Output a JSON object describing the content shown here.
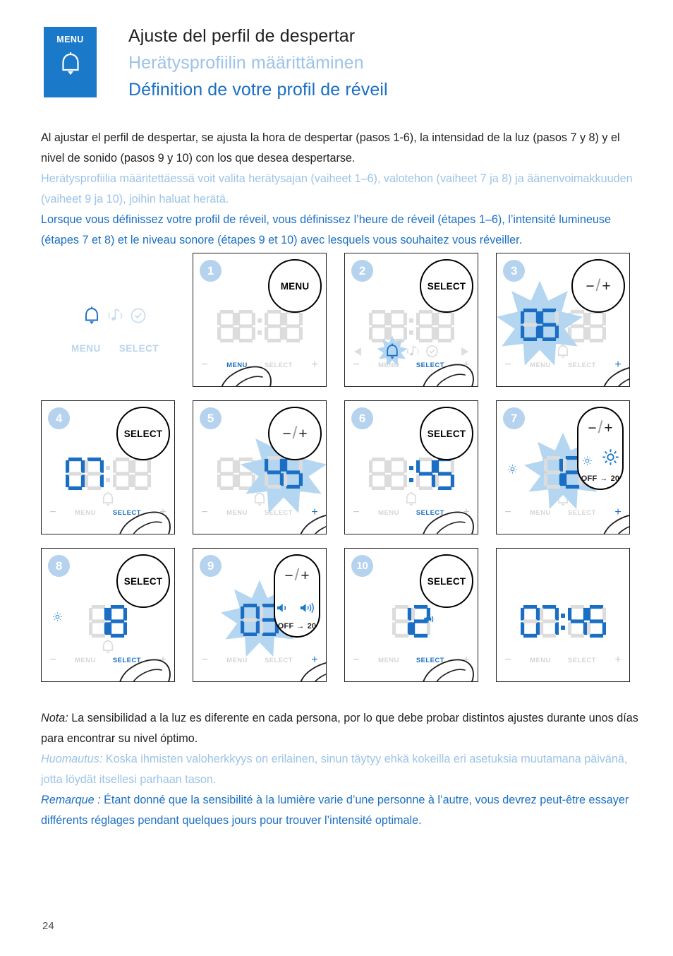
{
  "header": {
    "logo_label": "MENU",
    "logo_icon": "bell-icon",
    "title_es": "Ajuste del perfil de despertar",
    "title_fi": "Herätysprofiilin määrittäminen",
    "title_fr": "Définition de votre profil de réveil"
  },
  "intro": {
    "es": "Al ajustar el perfil de despertar, se ajusta la hora de despertar (pasos 1-6), la intensidad de la luz (pasos 7 y 8) y el nivel de sonido (pasos 9 y 10) con los que desea despertarse.",
    "fi": "Herätysprofiilia määritettäessä voit valita herätysajan (vaiheet 1–6), valotehon (vaiheet 7 ja 8) ja äänenvoimakkuuden (vaiheet 9 ja 10), joihin haluat herätä.",
    "fr": "Lorsque vous définissez votre profil de réveil, vous définissez l’heure de réveil (étapes 1–6), l’intensité lumineuse (étapes 7 et 8) et le niveau sonore (étapes 9 et 10) avec lesquels vous souhaitez vous réveiller."
  },
  "legend": {
    "icons": [
      "bell-icon",
      "music-note-icon",
      "clock-check-icon"
    ],
    "menu_label": "MENU",
    "select_label": "SELECT"
  },
  "steps": [
    {
      "number": "1",
      "button_label": "MENU",
      "button_type": "circle",
      "display": "00:00",
      "display_state": "off",
      "strip": {
        "minus": "−",
        "menu": "MENU",
        "select": "SELECT",
        "plus": "+",
        "highlight": "menu"
      },
      "thumb": true
    },
    {
      "number": "2",
      "button_label": "SELECT",
      "button_type": "circle",
      "display": "06:30",
      "display_state": "off",
      "icon_row": [
        "bell-icon",
        "music-note-icon",
        "clock-check-icon"
      ],
      "icon_row_active": "bell-icon",
      "arrows": true,
      "strip": {
        "minus": "−",
        "menu": "MENU",
        "select": "SELECT",
        "plus": "+",
        "highlight": "select"
      },
      "thumb": true
    },
    {
      "number": "3",
      "button_label": "−/+",
      "button_type": "circle",
      "display": "06:30",
      "display_state": "hours-flashing",
      "bell_under": true,
      "strip": {
        "minus": "−",
        "menu": "MENU",
        "select": "SELECT",
        "plus": "+",
        "highlight": "plus"
      },
      "thumb": true
    },
    {
      "number": "4",
      "button_label": "SELECT",
      "button_type": "circle",
      "display": "07:30",
      "display_state": "hours-on",
      "bell_under": true,
      "strip": {
        "minus": "−",
        "menu": "MENU",
        "select": "SELECT",
        "plus": "+",
        "highlight": "select"
      },
      "thumb": true
    },
    {
      "number": "5",
      "button_label": "−/+",
      "button_type": "circle",
      "display": "07:45",
      "display_state": "minutes-flashing",
      "bell_under": true,
      "strip": {
        "minus": "−",
        "menu": "MENU",
        "select": "SELECT",
        "plus": "+",
        "highlight": "plus"
      },
      "thumb": true
    },
    {
      "number": "6",
      "button_label": "SELECT",
      "button_type": "circle",
      "display": "07:45",
      "display_state": "minutes-on",
      "bell_under": true,
      "strip": {
        "minus": "−",
        "menu": "MENU",
        "select": "SELECT",
        "plus": "+",
        "highlight": "select"
      },
      "thumb": true
    },
    {
      "number": "7",
      "button_label": "−/+",
      "button_type": "tall",
      "callout_icons": [
        "sun-small-icon",
        "sun-large-icon"
      ],
      "callout_range_from": "OFF",
      "callout_range_arrow": "→",
      "callout_range_to": "20",
      "display": "12",
      "display_state": "flashing",
      "sun_left": true,
      "bell_under": true,
      "strip": {
        "minus": "−",
        "menu": "MENU",
        "select": "SELECT",
        "plus": "+",
        "highlight": "plus"
      },
      "thumb": true
    },
    {
      "number": "8",
      "button_label": "SELECT",
      "button_type": "circle",
      "display": "18",
      "display_state": "on",
      "sun_left": true,
      "bell_under": true,
      "strip": {
        "minus": "−",
        "menu": "MENU",
        "select": "SELECT",
        "plus": "+",
        "highlight": "select"
      },
      "thumb": true
    },
    {
      "number": "9",
      "button_label": "−/+",
      "button_type": "tall",
      "callout_icons": [
        "speaker-low-icon",
        "speaker-high-icon"
      ],
      "callout_range_from": "OFF",
      "callout_range_arrow": "→",
      "callout_range_to": "20",
      "display": "03",
      "display_state": "flashing",
      "speaker_right": true,
      "strip": {
        "minus": "−",
        "menu": "MENU",
        "select": "SELECT",
        "plus": "+",
        "highlight": "plus"
      },
      "thumb": true
    },
    {
      "number": "10",
      "button_label": "SELECT",
      "button_type": "circle",
      "display": "12",
      "display_state": "on",
      "speaker_right": true,
      "strip": {
        "minus": "−",
        "menu": "MENU",
        "select": "SELECT",
        "plus": "+",
        "highlight": "select"
      },
      "thumb": true
    },
    {
      "number": "",
      "button_label": "",
      "button_type": "none",
      "display": "07:45",
      "display_state": "on",
      "strip": {
        "minus": "−",
        "menu": "MENU",
        "select": "SELECT",
        "plus": "+",
        "highlight": "none"
      },
      "thumb": false
    }
  ],
  "note": {
    "es_label": "Nota:",
    "es": " La sensibilidad a la luz es diferente en cada persona, por lo que debe probar distintos ajustes durante unos días para encontrar su nivel óptimo.",
    "fi_label": "Huomautus:",
    "fi": " Koska ihmisten valoherkkyys on erilainen, sinun täytyy ehkä kokeilla eri asetuksia muutamana päivänä, jotta löydät itsellesi parhaan tason.",
    "fr_label": "Remarque :",
    "fr": " Étant donné que la sensibilité à la lumière varie d’une personne à l’autre, vous devrez peut-être essayer différents réglages pendant quelques jours pour trouver l’intensité optimale."
  },
  "page_number": "24",
  "colors": {
    "brand_blue": "#1a79c8",
    "digit_blue": "#1a6fc4",
    "light_blue": "#9cc3e8",
    "burst_blue": "#b5d6f0",
    "off_gray": "#dcdcdc"
  }
}
